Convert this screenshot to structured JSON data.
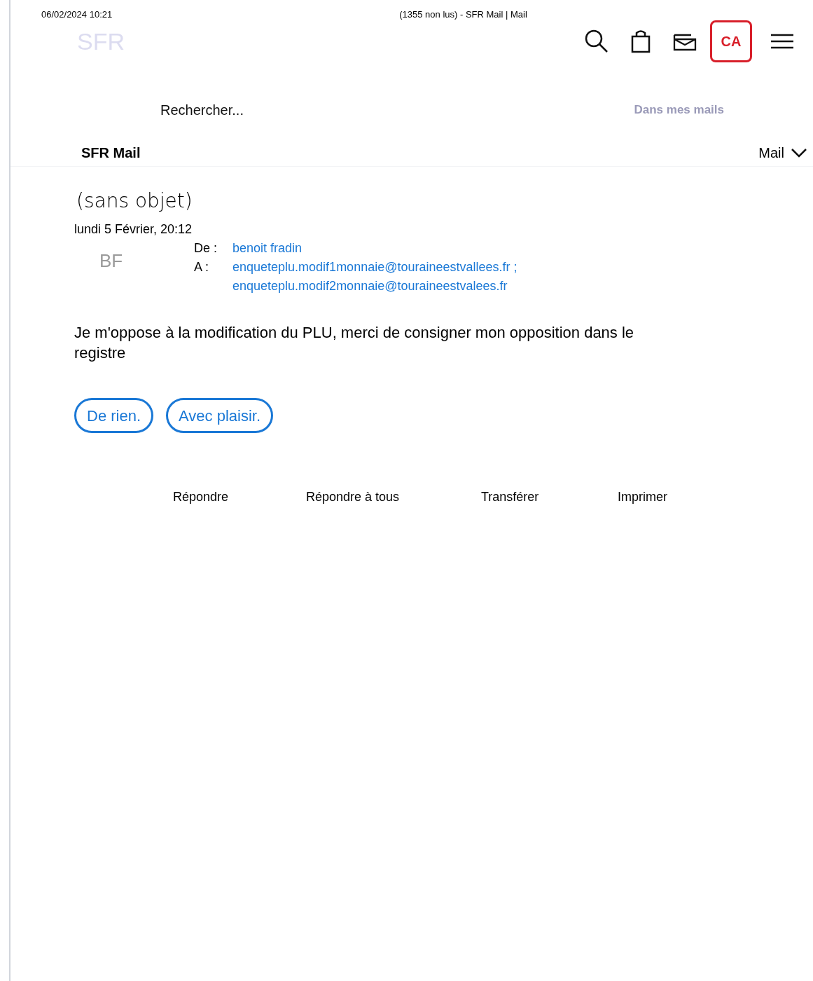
{
  "print_header": {
    "date": "06/02/2024 10:21",
    "title": "(1355 non lus) - SFR Mail | Mail"
  },
  "header": {
    "logo": "SFR",
    "account_initials": "CA"
  },
  "search": {
    "placeholder": "Rechercher...",
    "scope": "Dans mes mails"
  },
  "nav": {
    "title": "SFR Mail",
    "menu": "Mail"
  },
  "message": {
    "subject": "(sans objet)",
    "date": "lundi 5 Février, 20:12",
    "avatar": "BF",
    "from_label": "De :",
    "from": "benoit fradin",
    "to_label": "A :",
    "to": [
      "enqueteplu.modif1monnaie@touraineestvallees.fr ;",
      "enqueteplu.modif2monnaie@touraineestvalees.fr"
    ],
    "body": "Je m'oppose à la modification du PLU, merci de consigner mon opposition dans le registre"
  },
  "quick_replies": [
    "De rien.",
    "Avec plaisir."
  ],
  "actions": [
    "Répondre",
    "Répondre à tous",
    "Transférer",
    "Imprimer"
  ]
}
